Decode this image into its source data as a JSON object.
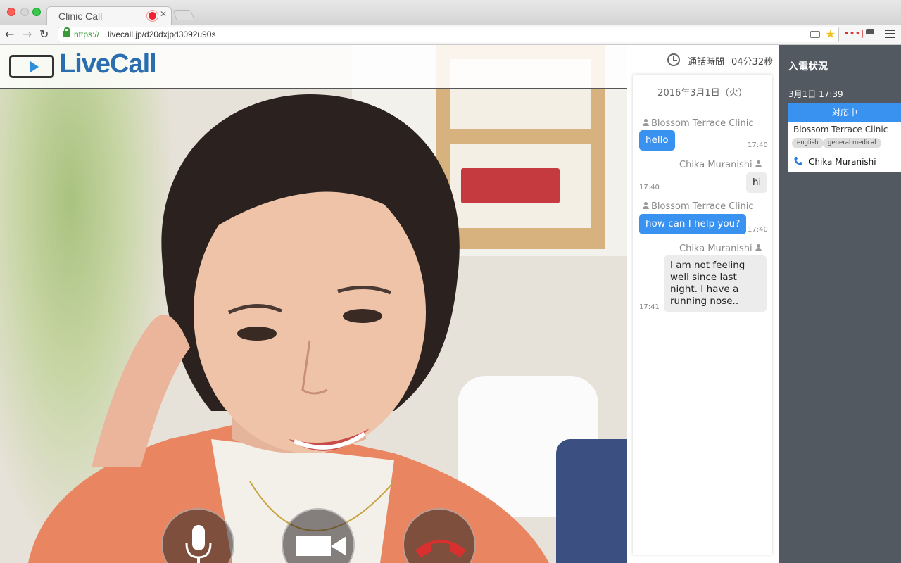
{
  "browser": {
    "tab_title": "Clinic Call",
    "url_scheme": "https://",
    "url_host": "livecall.jp/d20dxjpd3092u90s",
    "extension_badge": "•••|"
  },
  "header": {
    "logo_text": "LiveCall"
  },
  "call_controls": {
    "mic_icon": "microphone-icon",
    "camera_icon": "video-camera-icon",
    "hangup_icon": "phone-hangup-icon"
  },
  "chat": {
    "timer_label": "通話時間",
    "timer_value": "04分32秒",
    "date": "2016年3月1日（火）",
    "messages": [
      {
        "sender": "Blossom Terrace Clinic",
        "text": "hello",
        "time": "17:40",
        "direction": "in"
      },
      {
        "sender": "Chika Muranishi",
        "text": "hi",
        "time": "17:40",
        "direction": "out"
      },
      {
        "sender": "Blossom Terrace Clinic",
        "text": "how can I help you?",
        "time": "17:40",
        "direction": "in"
      },
      {
        "sender": "Chika Muranishi",
        "text": "I am not feeling well since last night. I have a running nose..",
        "time": "17:41",
        "direction": "out"
      }
    ]
  },
  "status_panel": {
    "title": "入電状況",
    "date": "3月1日 17:39",
    "card": {
      "status": "対応中",
      "clinic": "Blossom Terrace Clinic",
      "tags": [
        "english",
        "general medical"
      ],
      "caller": "Chika Muranishi"
    }
  },
  "colors": {
    "accent": "#3a92f0",
    "status_panel_bg": "#535960",
    "hangup_red": "#d8302f"
  }
}
